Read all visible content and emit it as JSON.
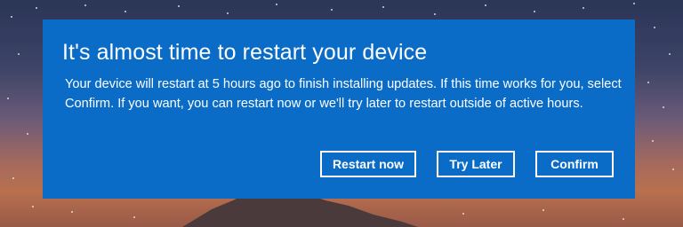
{
  "dialog": {
    "title": "It's almost time to restart your device",
    "message": "Your device will restart at 5 hours ago to finish installing updates. If this time works for you, select Confirm. If you want, you can restart now or we'll try later to restart outside of active hours.",
    "buttons": {
      "restart_now": "Restart now",
      "try_later": "Try Later",
      "confirm": "Confirm"
    },
    "accent_color": "#0a6cc6"
  },
  "background": {
    "description_icons": [
      "starry-sky",
      "mountain-peak"
    ]
  }
}
